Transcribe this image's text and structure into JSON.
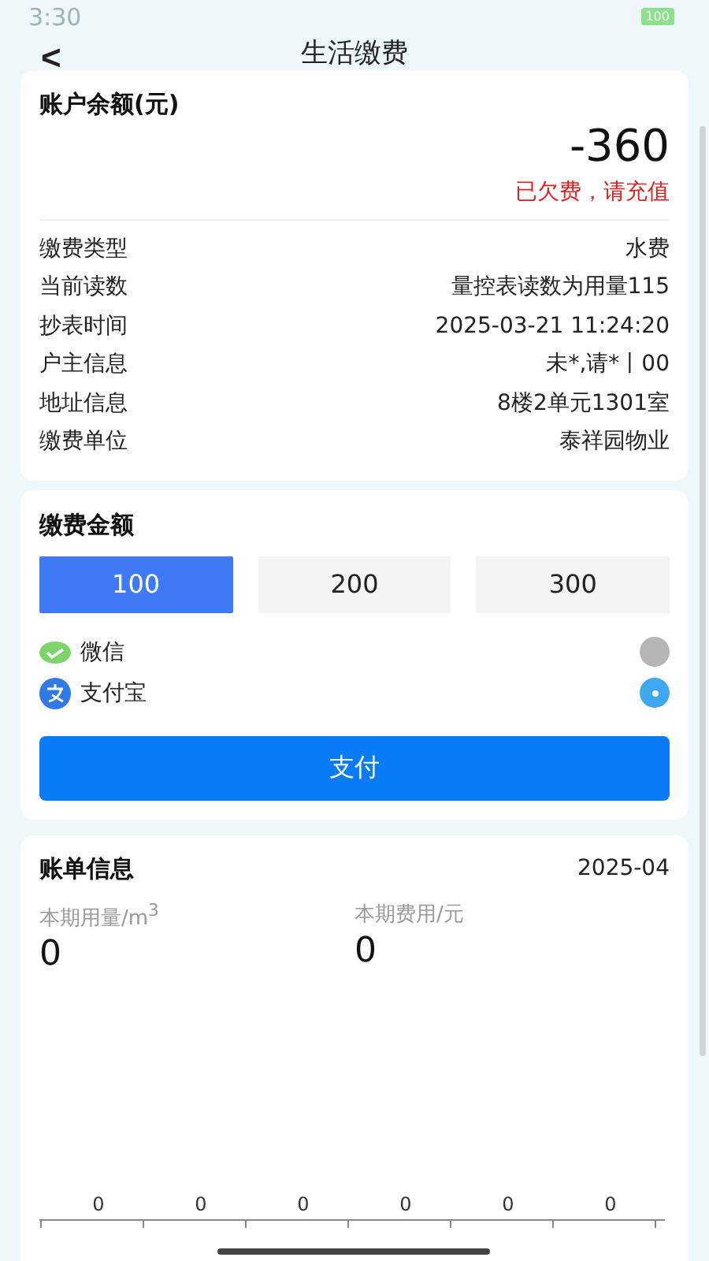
{
  "status_bar": {
    "time": "3:30",
    "battery": "100"
  },
  "header": {
    "back": "<",
    "title": "生活缴费"
  },
  "balance": {
    "label": "账户余额(元)",
    "amount": "-360",
    "notice": "已欠费，请充值"
  },
  "details": [
    {
      "label": "缴费类型",
      "value": "水费"
    },
    {
      "label": "当前读数",
      "value": "量控表读数为用量115"
    },
    {
      "label": "抄表时间",
      "value": "2025-03-21 11:24:20"
    },
    {
      "label": "户主信息",
      "value": "未*,请*丨00"
    },
    {
      "label": "地址信息",
      "value": "8楼2单元1301室"
    },
    {
      "label": "缴费单位",
      "value": "泰祥园物业"
    }
  ],
  "payment": {
    "title": "缴费金额",
    "amounts": [
      {
        "label": "100",
        "selected": true
      },
      {
        "label": "200",
        "selected": false
      },
      {
        "label": "300",
        "selected": false
      }
    ],
    "methods": [
      {
        "kind": "wechat",
        "label": "微信",
        "selected": false
      },
      {
        "kind": "alipay",
        "label": "支付宝",
        "selected": true
      }
    ],
    "pay_button": "支付"
  },
  "bill": {
    "title": "账单信息",
    "month": "2025-04",
    "stats": [
      {
        "label": "本期用量/m$^{3}$",
        "value": "0"
      },
      {
        "label": "本期费用/元",
        "value": "0"
      }
    ],
    "chart_labels": [
      "0",
      "0",
      "0",
      "0",
      "0",
      "0"
    ]
  }
}
